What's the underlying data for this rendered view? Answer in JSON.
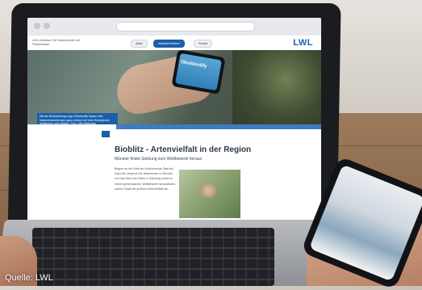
{
  "browser": {
    "site_subtitle": "LWL-Museum für Naturkunde mit Planetarium",
    "nav_items": [
      "Aktiv",
      "Initiative/Aktion",
      "Suche"
    ]
  },
  "site": {
    "logo": "LWL",
    "hero_phone_label": "ObsIdentify",
    "hero_caption": "Mit der Beobachtungs-App ObsIdentify lassen sich Naturbeobachtungen ganz einfach mit dem Smartphone bestimmen und melden. Foto: LWL/Steinweg"
  },
  "article": {
    "title": "Bioblitz - Artenvielfalt in der Region",
    "subtitle": "Münster findet Sieblung zum Wettbewerb heraus",
    "body": "Beginn an der Welt am Wochenende Statt bei Das LWL-Museum für Naturkunde in Münster und das Haus der Natur in Salzburg wollen in einem gemeinsamen Wettbewerb herausfinden, welche Stadt die größere Artenvielfalt hat."
  },
  "credit": "Quelle: LWL"
}
